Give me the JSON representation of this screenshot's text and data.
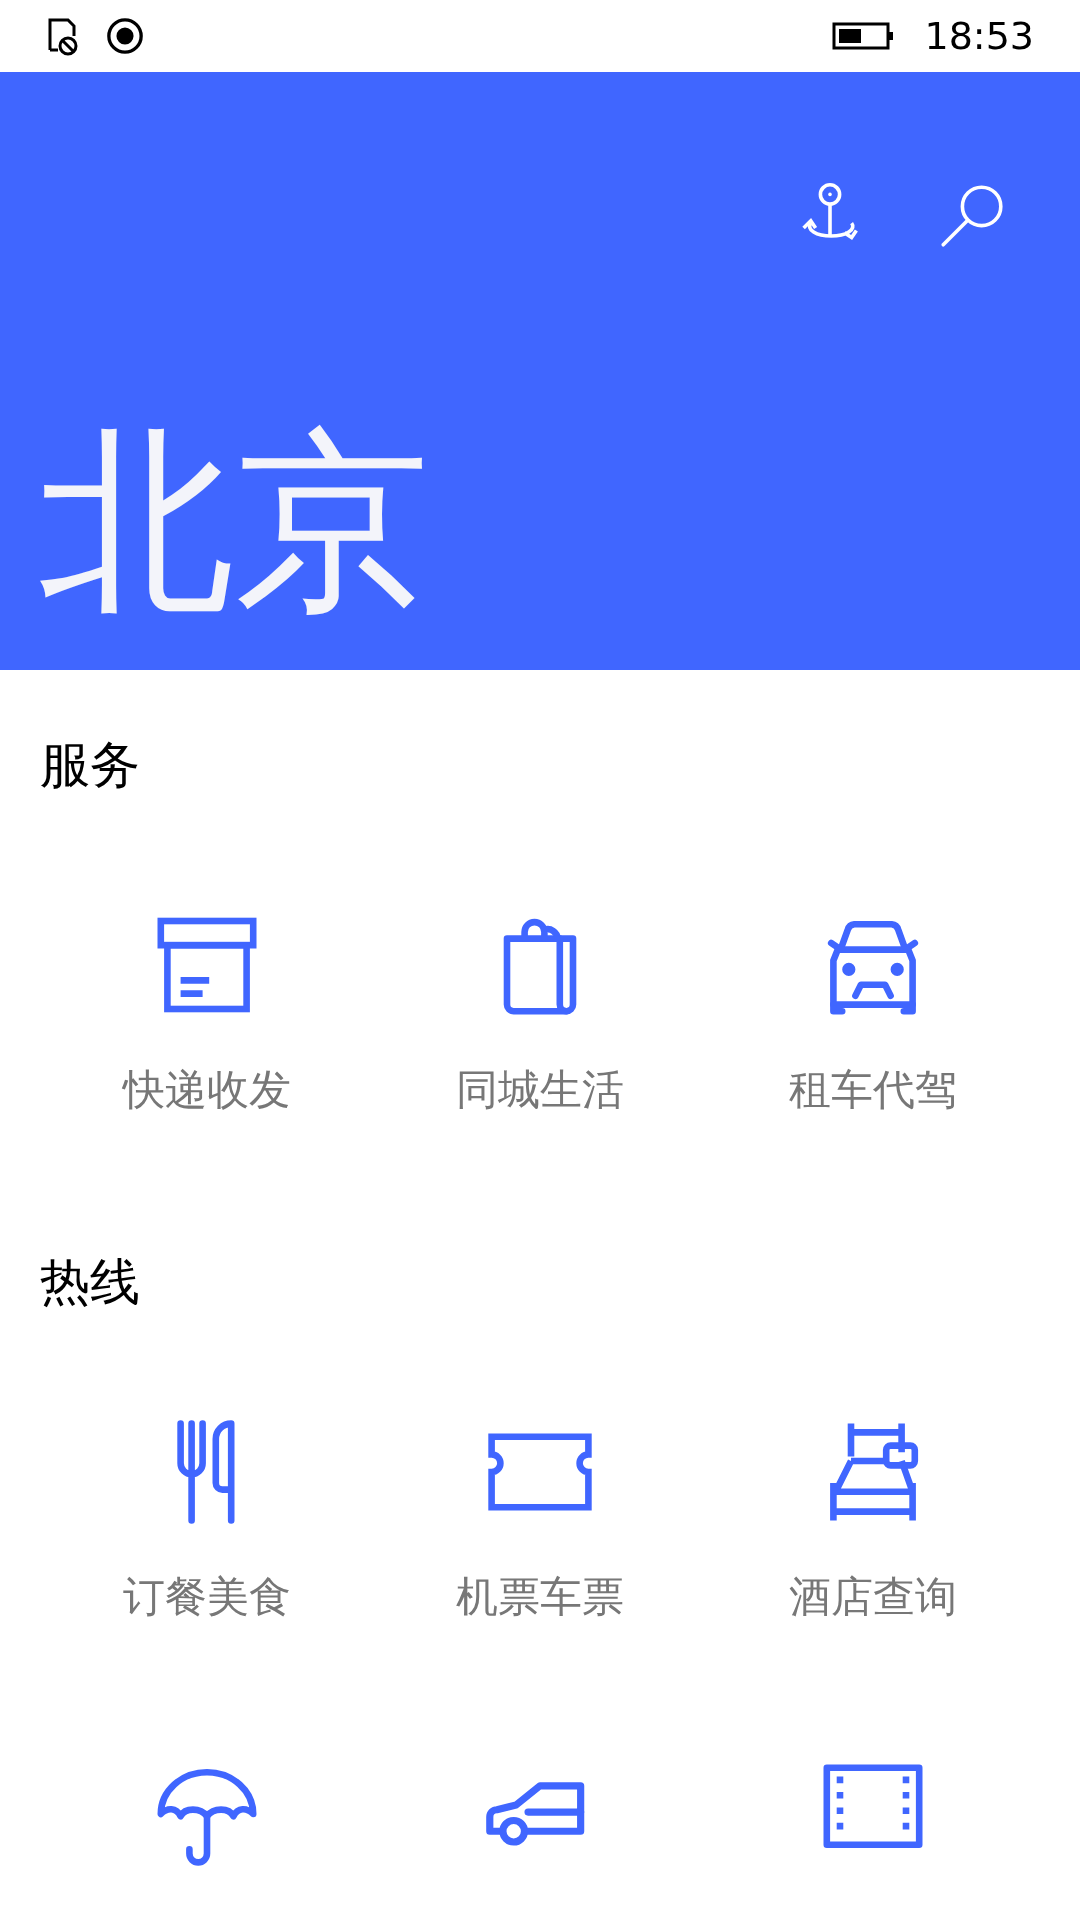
{
  "status_bar": {
    "time": "18:53"
  },
  "header": {
    "title": "北京"
  },
  "sections": [
    {
      "title": "服务",
      "items": [
        {
          "kind": "box",
          "label": "快递收发"
        },
        {
          "kind": "bag",
          "label": "同城生活"
        },
        {
          "kind": "car",
          "label": "租车代驾"
        }
      ]
    },
    {
      "title": "热线",
      "items": [
        {
          "kind": "dining",
          "label": "订餐美食"
        },
        {
          "kind": "ticket",
          "label": "机票车票"
        },
        {
          "kind": "hotel",
          "label": "酒店查询"
        },
        {
          "kind": "umbrella"
        },
        {
          "kind": "car-side"
        },
        {
          "kind": "film"
        }
      ]
    }
  ]
}
